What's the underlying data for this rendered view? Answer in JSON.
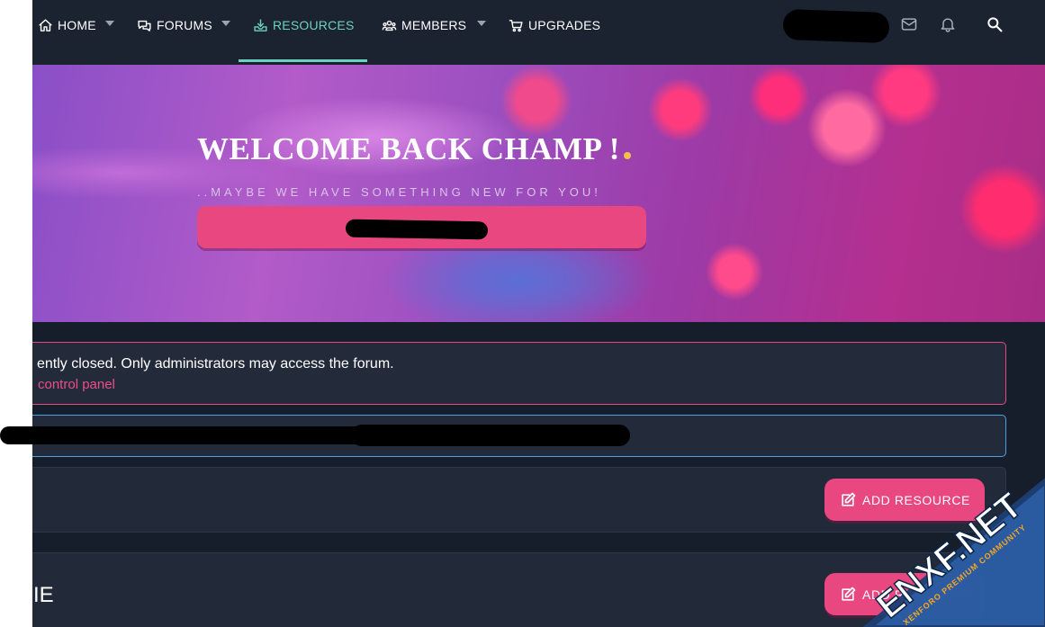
{
  "nav": {
    "items": [
      {
        "label": "HOME",
        "icon": "home-icon",
        "has_dropdown": true
      },
      {
        "label": "FORUMS",
        "icon": "comments-icon",
        "has_dropdown": true
      },
      {
        "label": "RESOURCES",
        "icon": "download-tray-icon",
        "has_dropdown": false,
        "active": true
      },
      {
        "label": "MEMBERS",
        "icon": "users-icon",
        "has_dropdown": true
      },
      {
        "label": "UPGRADES",
        "icon": "cart-icon",
        "has_dropdown": false
      }
    ],
    "right_icons": [
      "envelope-icon",
      "bell-icon",
      "search-icon"
    ],
    "active_color": "#6fd0c2"
  },
  "hero": {
    "title": "WELCOME BACK CHAMP !",
    "subtitle": "..MAYBE WE HAVE SOMETHING NEW FOR YOU!",
    "button_color": "#e9477f",
    "accent_dot_color": "#f5c04a"
  },
  "notices": {
    "closed_text": "ently closed. Only administrators may access the forum.",
    "closed_link": "control panel",
    "closed_border": "#e34a86",
    "info_border": "#4f9fe3"
  },
  "blocks": [
    {
      "title": "",
      "button_label": "ADD RESOURCE",
      "button_icon": "edit-icon"
    },
    {
      "title": "IE",
      "button_label": "ADD RESOURCE",
      "button_icon": "edit-icon"
    }
  ],
  "watermark": {
    "main": "ENXF.NET",
    "sub": "XENFORO PREMIUM COMMUNITY"
  },
  "colors": {
    "page_bg": "#171e2b",
    "nav_bg": "#1b2230",
    "accent_pink": "#e9477f"
  }
}
